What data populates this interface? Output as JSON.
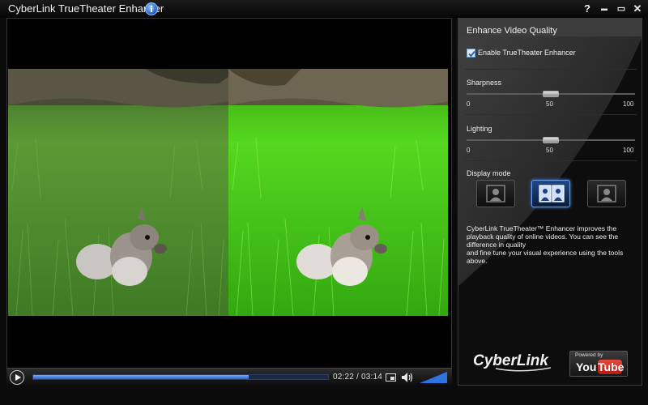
{
  "window": {
    "title": "CyberLink TrueTheater Enhancer",
    "title_icon": "info-icon",
    "controls": [
      "help-icon",
      "minimize-icon",
      "restore-icon",
      "close-icon"
    ],
    "help_label": "?",
    "minimize_label": "▬",
    "restore_label": "▭",
    "close_label": "✕"
  },
  "player": {
    "time_current": "02:22",
    "time_separator": "/",
    "time_total": "03:14",
    "progress": 0.73,
    "volume": 1.0,
    "comparison": [
      "original",
      "enhanced"
    ]
  },
  "panel": {
    "title": "Enhance Video Quality",
    "enable_label": "Enable TrueTheater Enhancer",
    "enable_checked": true,
    "sharpness": {
      "label": "Sharpness",
      "value": 50,
      "min_label": "0",
      "mid_label": "50",
      "max_label": "100"
    },
    "lighting": {
      "label": "Lighting",
      "value": 50,
      "min_label": "0",
      "mid_label": "50",
      "max_label": "100"
    },
    "display_mode": {
      "label": "Display mode",
      "options": [
        "original",
        "split-compare",
        "enhanced"
      ],
      "selected": "split-compare"
    },
    "description": [
      "CyberLink TrueTheater™ Enhancer improves the playback quality of online videos. You can see the difference in quality",
      "and fine tune your visual experience using the tools above."
    ],
    "brand": "CyberLink",
    "youtube_powered": "Powered by",
    "youtube_you": "You",
    "youtube_tube": "Tube"
  },
  "colors": {
    "accent": "#2a63d0",
    "grass_original": "#4c8a2c",
    "grass_enhanced": "#3fbf1c"
  }
}
